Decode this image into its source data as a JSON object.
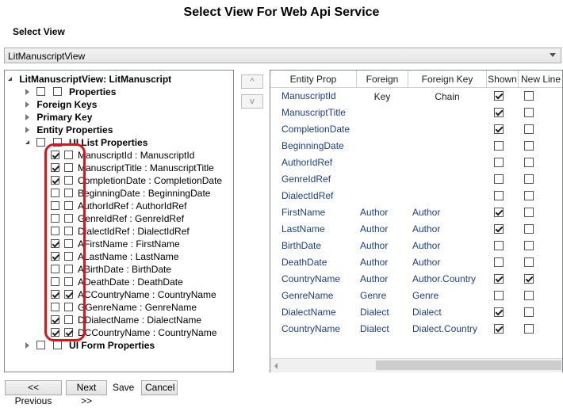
{
  "window": {
    "title": "Select View For Web Api Service"
  },
  "view_selector": {
    "label": "Select View",
    "selected": "LitManuscriptView"
  },
  "tree": {
    "root": "LitManuscriptView: LitManuscript",
    "nodes": [
      {
        "label": "Properties"
      },
      {
        "label": "Foreign Keys"
      },
      {
        "label": "Primary Key"
      },
      {
        "label": "Entity Properties"
      },
      {
        "label": "UI List Properties"
      },
      {
        "label": "UI Form Properties"
      }
    ],
    "list_items": [
      {
        "label": "ManuscriptId : ManuscriptId",
        "a": true,
        "b": false
      },
      {
        "label": "ManuscriptTitle : ManuscriptTitle",
        "a": true,
        "b": false
      },
      {
        "label": "CompletionDate : CompletionDate",
        "a": true,
        "b": false
      },
      {
        "label": "BeginningDate : BeginningDate",
        "a": false,
        "b": false
      },
      {
        "label": "AuthorIdRef : AuthorIdRef",
        "a": false,
        "b": false
      },
      {
        "label": "GenreIdRef : GenreIdRef",
        "a": false,
        "b": false
      },
      {
        "label": "DialectIdRef : DialectIdRef",
        "a": false,
        "b": false
      },
      {
        "label": "AFirstName : FirstName",
        "a": true,
        "b": false
      },
      {
        "label": "ALastName : LastName",
        "a": true,
        "b": false
      },
      {
        "label": "ABirthDate : BirthDate",
        "a": false,
        "b": false
      },
      {
        "label": "ADeathDate : DeathDate",
        "a": false,
        "b": false
      },
      {
        "label": "ACCountryName : CountryName",
        "a": true,
        "b": true
      },
      {
        "label": "GGenreName : GenreName",
        "a": false,
        "b": false
      },
      {
        "label": "DDialectName : DialectName",
        "a": true,
        "b": false
      },
      {
        "label": "DCCountryName : CountryName",
        "a": true,
        "b": true
      }
    ]
  },
  "move_buttons": {
    "up": "^",
    "down": "v"
  },
  "grid": {
    "headers": [
      "Entity Prop",
      "Foreign Key",
      "Foreign Key Chain",
      "Shown",
      "New Line"
    ],
    "rows": [
      {
        "prop": "ManuscriptId",
        "fk": "",
        "chain": "",
        "shown": true,
        "newline": false
      },
      {
        "prop": "ManuscriptTitle",
        "fk": "",
        "chain": "",
        "shown": true,
        "newline": false
      },
      {
        "prop": "CompletionDate",
        "fk": "",
        "chain": "",
        "shown": true,
        "newline": false
      },
      {
        "prop": "BeginningDate",
        "fk": "",
        "chain": "",
        "shown": false,
        "newline": false
      },
      {
        "prop": "AuthorIdRef",
        "fk": "",
        "chain": "",
        "shown": false,
        "newline": false
      },
      {
        "prop": "GenreIdRef",
        "fk": "",
        "chain": "",
        "shown": false,
        "newline": false
      },
      {
        "prop": "DialectIdRef",
        "fk": "",
        "chain": "",
        "shown": false,
        "newline": false
      },
      {
        "prop": "FirstName",
        "fk": "Author",
        "chain": "Author",
        "shown": true,
        "newline": false
      },
      {
        "prop": "LastName",
        "fk": "Author",
        "chain": "Author",
        "shown": true,
        "newline": false
      },
      {
        "prop": "BirthDate",
        "fk": "Author",
        "chain": "Author",
        "shown": false,
        "newline": false
      },
      {
        "prop": "DeathDate",
        "fk": "Author",
        "chain": "Author",
        "shown": false,
        "newline": false
      },
      {
        "prop": "CountryName",
        "fk": "Author",
        "chain": "Author.Country",
        "shown": true,
        "newline": true
      },
      {
        "prop": "GenreName",
        "fk": "Genre",
        "chain": "Genre",
        "shown": false,
        "newline": false
      },
      {
        "prop": "DialectName",
        "fk": "Dialect",
        "chain": "Dialect",
        "shown": true,
        "newline": false
      },
      {
        "prop": "CountryName",
        "fk": "Dialect",
        "chain": "Dialect.Country",
        "shown": true,
        "newline": false
      }
    ]
  },
  "footer": {
    "previous": "<< Previous",
    "next": "Next >>",
    "save": "Save",
    "cancel": "Cancel"
  },
  "colors": {
    "annotation": "#e0121b",
    "grid_text": "#1d3f8a"
  }
}
